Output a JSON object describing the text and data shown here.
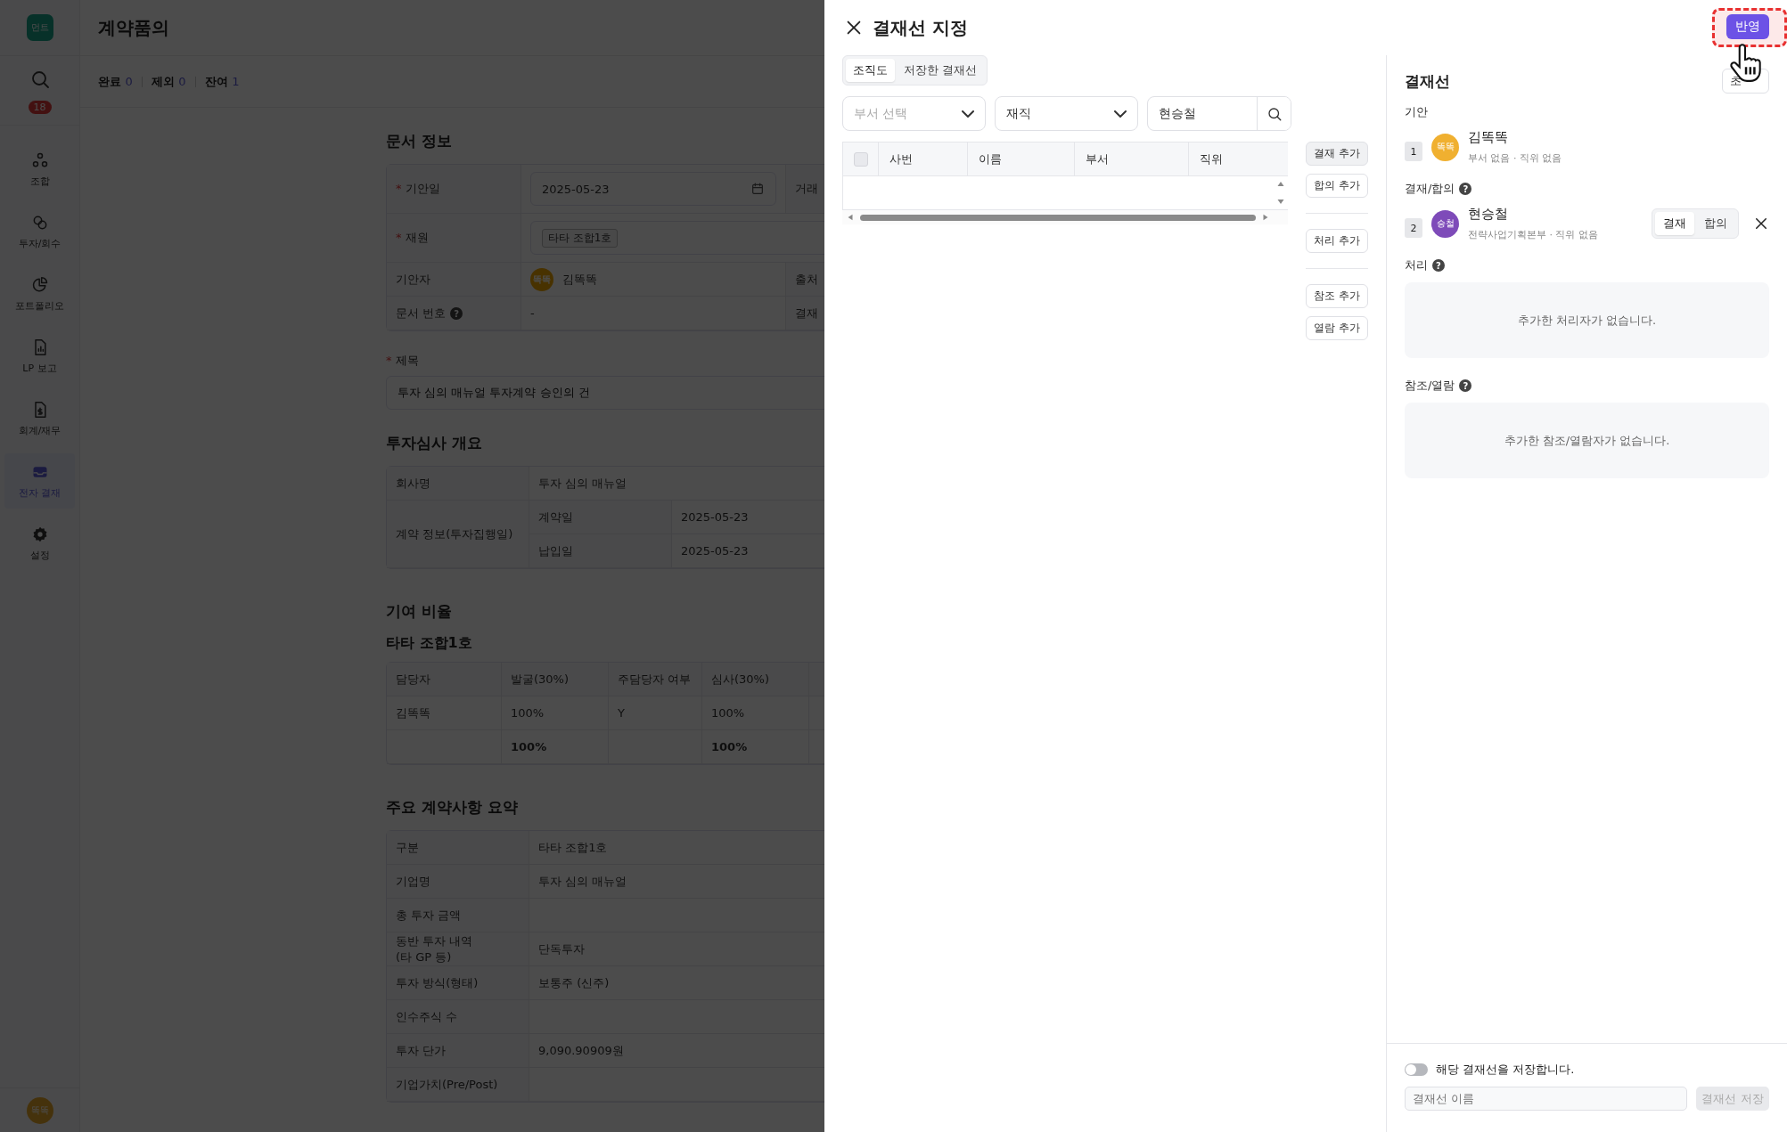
{
  "app": {
    "logo": "먼트",
    "title": "계약품의",
    "counts": [
      {
        "label": "완료",
        "value": "0"
      },
      {
        "label": "제외",
        "value": "0"
      },
      {
        "label": "잔여",
        "value": "1"
      }
    ],
    "sidebar": {
      "notification_count": "18",
      "items": [
        {
          "label": "조합",
          "selected": false
        },
        {
          "label": "투자/회수",
          "selected": false
        },
        {
          "label": "포트폴리오",
          "selected": false
        },
        {
          "label": "LP 보고",
          "selected": false
        },
        {
          "label": "회계/재무",
          "selected": false
        },
        {
          "label": "전자 결재",
          "selected": true
        },
        {
          "label": "설정",
          "selected": false
        }
      ],
      "user_avatar": "똑똑"
    }
  },
  "document": {
    "sections": [
      {
        "heading": "문서 정보",
        "table": {
          "rows": [
            [
              {
                "kind": "label",
                "mark": "*",
                "text": "기안일"
              },
              {
                "kind": "date",
                "text": "2025-05-23"
              },
              {
                "kind": "label",
                "text": "거래"
              }
            ],
            [
              {
                "kind": "label",
                "mark": "*",
                "text": "재원"
              },
              {
                "kind": "tag",
                "text": "타타 조합1호",
                "colspan": 2
              }
            ],
            [
              {
                "kind": "label",
                "text": "기안자"
              },
              {
                "kind": "person",
                "avatar": "똑똑",
                "text": "김똑똑"
              },
              {
                "kind": "label",
                "text": "출처"
              }
            ],
            [
              {
                "kind": "label",
                "text": "문서 번호",
                "help": "?"
              },
              {
                "kind": "value",
                "text": "-"
              },
              {
                "kind": "label",
                "text": "결재"
              }
            ]
          ]
        }
      },
      {
        "field": {
          "mark": "*",
          "label": "제목",
          "value": "투자 심의 매뉴얼 투자계약 승인의 건"
        }
      },
      {
        "heading": "투자심사 개요",
        "table": {
          "rows": [
            [
              {
                "kind": "label",
                "text": "회사명"
              },
              {
                "kind": "value",
                "text": "투자 심의 매뉴얼",
                "colspan": 2
              }
            ],
            [
              {
                "kind": "label",
                "text": "계약 정보(투자집행일)",
                "rowspan": 2
              },
              {
                "kind": "label",
                "text": "계약일"
              },
              {
                "kind": "value",
                "text": "2025-05-23"
              }
            ],
            [
              {
                "kind": "label",
                "text": "납입일"
              },
              {
                "kind": "value",
                "text": "2025-05-23"
              }
            ]
          ]
        }
      },
      {
        "heading": "기여 비율",
        "subheading": "타타 조합1호",
        "table": {
          "rows": [
            [
              {
                "kind": "label",
                "text": "담당자"
              },
              {
                "kind": "label",
                "text": "발굴(30%)"
              },
              {
                "kind": "label",
                "text": "주담당자 여부"
              },
              {
                "kind": "label",
                "text": "심사(30%)"
              },
              {
                "kind": "label"
              }
            ],
            [
              {
                "kind": "value",
                "text": "김똑똑"
              },
              {
                "kind": "value",
                "text": "100%"
              },
              {
                "kind": "value",
                "text": "Y"
              },
              {
                "kind": "value",
                "text": "100%"
              },
              {
                "kind": "value"
              }
            ],
            [
              {
                "kind": "value"
              },
              {
                "kind": "total",
                "text": "100%"
              },
              {
                "kind": "value"
              },
              {
                "kind": "total",
                "text": "100%"
              },
              {
                "kind": "value"
              }
            ]
          ]
        }
      },
      {
        "heading": "주요 계약사항 요약",
        "table": {
          "rows": [
            [
              {
                "kind": "label",
                "text": "구분"
              },
              {
                "kind": "value",
                "text": "타타 조합1호"
              }
            ],
            [
              {
                "kind": "label",
                "text": "기업명"
              },
              {
                "kind": "value",
                "text": "투자 심의 매뉴얼"
              }
            ],
            [
              {
                "kind": "label",
                "text": "총 투자 금액"
              },
              {
                "kind": "value"
              }
            ],
            [
              {
                "kind": "label",
                "text": "동반 투자 내역\n(타 GP 등)"
              },
              {
                "kind": "value",
                "text": "단독투자"
              }
            ],
            [
              {
                "kind": "label",
                "text": "투자 방식(형태)"
              },
              {
                "kind": "value",
                "text": "보통주 (신주)"
              }
            ],
            [
              {
                "kind": "label",
                "text": "인수주식 수"
              },
              {
                "kind": "value"
              }
            ],
            [
              {
                "kind": "label",
                "text": "투자 단가"
              },
              {
                "kind": "value",
                "text": "9,090.90909원"
              }
            ],
            [
              {
                "kind": "label",
                "text": "기업가치(Pre/Post)"
              },
              {
                "kind": "value"
              }
            ]
          ]
        }
      }
    ]
  },
  "modal": {
    "title": "결재선 지정",
    "apply_button": "반영",
    "tabs": [
      {
        "label": "조직도",
        "selected": true
      },
      {
        "label": "저장한 결재선",
        "selected": false
      }
    ],
    "department_select": {
      "placeholder": "부서 선택"
    },
    "status_select": {
      "value": "재직"
    },
    "search": {
      "value": "현승철"
    },
    "table": {
      "checked": false,
      "columns": [
        "사번",
        "이름",
        "부서",
        "직위"
      ]
    },
    "action_groups": [
      [
        {
          "label": "결재 추가",
          "hovered": true
        },
        {
          "label": "합의 추가",
          "hovered": false
        }
      ],
      [
        {
          "label": "처리 추가",
          "hovered": false
        }
      ],
      [
        {
          "label": "참조 추가",
          "hovered": false
        },
        {
          "label": "열람 추가",
          "hovered": false
        }
      ]
    ],
    "line": {
      "title": "결재선",
      "reset_button": "초",
      "sections": [
        {
          "label": "기안",
          "people": [
            {
              "order": "1",
              "avatar": "똑똑",
              "color": "#f0b030",
              "name": "김똑똑",
              "detail": "부서 없음 · 직위 없음"
            }
          ]
        },
        {
          "label": "결재/합의",
          "help": "?",
          "people": [
            {
              "order": "2",
              "avatar": "승철",
              "color": "#7e4bb9",
              "name": "현승철",
              "detail": "전략사업기획본부 · 직위 없음",
              "removable": true,
              "types": [
                {
                  "label": "결재",
                  "selected": true
                },
                {
                  "label": "합의",
                  "selected": false
                }
              ]
            }
          ]
        },
        {
          "label": "처리",
          "help": "?",
          "empty": "추가한 처리자가 없습니다."
        },
        {
          "label": "참조/열람",
          "help": "?",
          "empty": "추가한 참조/열람자가 없습니다."
        }
      ],
      "save_toggle": {
        "label": "해당 결재선을 저장합니다.",
        "on": false
      },
      "name_field": {
        "placeholder": "결재선 이름"
      },
      "save_button": {
        "label": "결재선 저장",
        "disabled": true
      }
    }
  }
}
